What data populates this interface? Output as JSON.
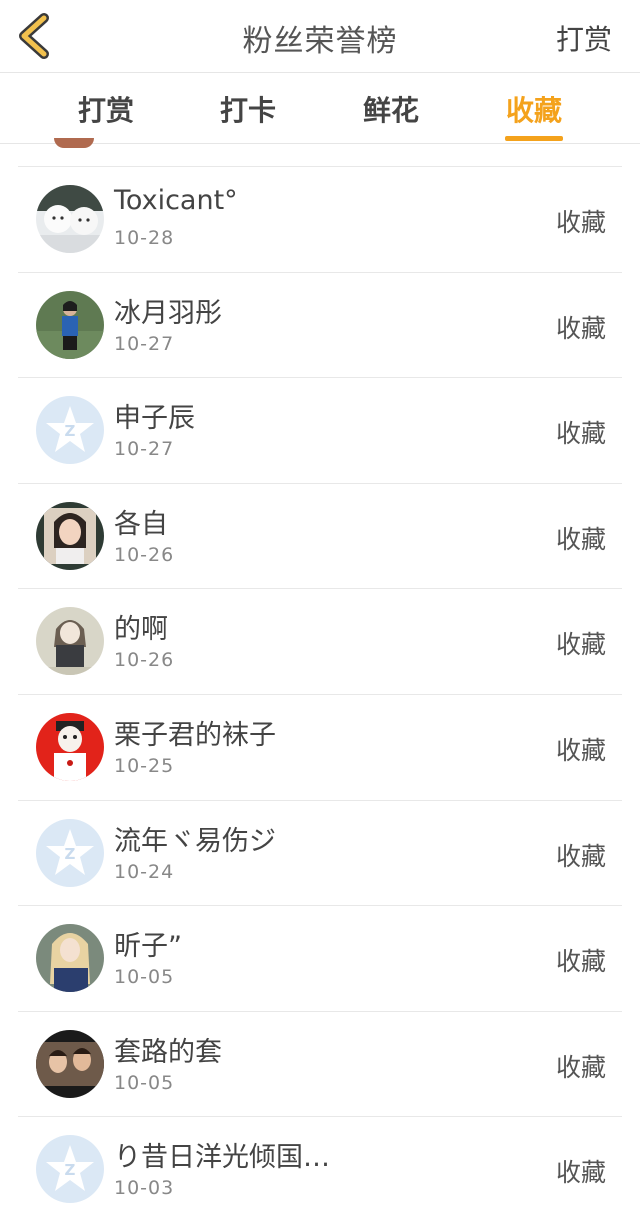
{
  "header": {
    "title": "粉丝荣誉榜",
    "right_action": "打赏"
  },
  "tabs": [
    {
      "label": "打赏",
      "active": false
    },
    {
      "label": "打卡",
      "active": false
    },
    {
      "label": "鲜花",
      "active": false
    },
    {
      "label": "收藏",
      "active": true
    }
  ],
  "colors": {
    "accent": "#f4a21c",
    "back_icon": "#f2c14e"
  },
  "list": [
    {
      "name": "Toxicant°",
      "date": "10-28",
      "action": "收藏",
      "avatar": "dogs-photo"
    },
    {
      "name": "冰月羽彤",
      "date": "10-27",
      "action": "收藏",
      "avatar": "girl-outdoor-photo"
    },
    {
      "name": "申子辰",
      "date": "10-27",
      "action": "收藏",
      "avatar": "default-star-avatar"
    },
    {
      "name": "各自",
      "date": "10-26",
      "action": "收藏",
      "avatar": "girl-portrait-photo"
    },
    {
      "name": "的啊",
      "date": "10-26",
      "action": "收藏",
      "avatar": "anime-girl-drawing"
    },
    {
      "name": "栗子君的袜子",
      "date": "10-25",
      "action": "收藏",
      "avatar": "cartoon-man-red"
    },
    {
      "name": "流年ヾ易伤ジ",
      "date": "10-24",
      "action": "收藏",
      "avatar": "default-star-avatar"
    },
    {
      "name": "昕子”",
      "date": "10-05",
      "action": "收藏",
      "avatar": "blonde-girl-photo"
    },
    {
      "name": "套路的套",
      "date": "10-05",
      "action": "收藏",
      "avatar": "two-people-photo"
    },
    {
      "name": "り昔日洋光倾国…",
      "date": "10-03",
      "action": "收藏",
      "avatar": "default-star-avatar"
    }
  ]
}
